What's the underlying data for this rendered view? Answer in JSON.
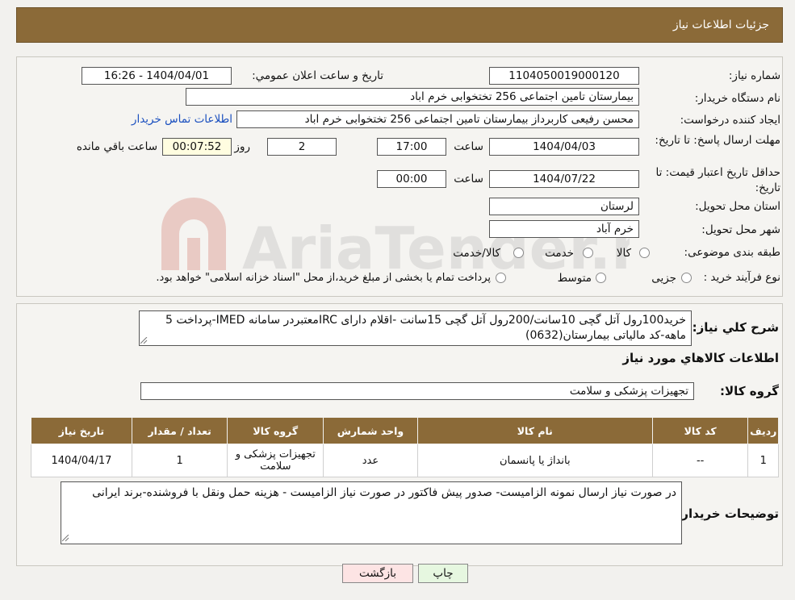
{
  "header": {
    "title": "جزئیات اطلاعات نیاز"
  },
  "form": {
    "need_number_label": "شماره نیاز:",
    "need_number": "1104050019000120",
    "announce_label": "تاریخ و ساعت اعلان عمومي:",
    "announce_value": "1404/04/01 - 16:26",
    "buyer_org_label": "نام دستگاه خریدار:",
    "buyer_org": "بیمارستان تامین اجتماعی  256 تختخوابی خرم اباد",
    "creator_label": "ایجاد کننده درخواست:",
    "creator": "محسن رفیعی کاربرداز بیمارستان تامین اجتماعی  256 تختخوابی خرم اباد",
    "contact_link": "اطلاعات تماس خریدار",
    "deadline_label": "مهلت ارسال پاسخ: تا تاریخ:",
    "deadline_date": "1404/04/03",
    "time_label": "ساعت",
    "deadline_time": "17:00",
    "days_value": "2",
    "days_label": "روز و",
    "remaining_time": "00:07:52",
    "remaining_label": "ساعت باقي مانده",
    "validity_label": "حداقل تاریخ اعتبار قیمت: تا تاریخ:",
    "validity_date": "1404/07/22",
    "validity_time": "00:00",
    "province_label": "استان محل تحویل:",
    "province": "لرستان",
    "city_label": "شهر محل تحویل:",
    "city": "خرم آباد",
    "category_label": "طبقه بندی موضوعی:",
    "category_options": [
      "کالا",
      "خدمت",
      "کالا/خدمت"
    ],
    "process_label": "نوع فرآیند خرید :",
    "process_options": [
      "جزیی",
      "متوسط"
    ],
    "process_note": "پرداخت تمام یا بخشی از مبلغ خرید،از محل \"اسناد خزانه اسلامی\" خواهد بود."
  },
  "description": {
    "label": "شرح کلي نیاز:",
    "text": "خرید100رول آتل گچی 10سانت/200رول آتل گچی 15سانت -اقلام دارای IRCمعتبردر سامانه IMED-پرداخت 5 ماهه-کد مالیاتی بیمارستان(0632)"
  },
  "goods": {
    "section_title": "اطلاعات کالاهاي مورد نیاز",
    "group_label": "گروه کالا:",
    "group_value": "تجهیزات پزشکی و سلامت"
  },
  "table": {
    "headers": [
      "ردیف",
      "کد کالا",
      "نام کالا",
      "واحد شمارش",
      "گروه کالا",
      "تعداد / مقدار",
      "تاریخ نیاز"
    ],
    "rows": [
      [
        "1",
        "--",
        "بانداژ یا پانسمان",
        "عدد",
        "تجهیزات پزشکی و سلامت",
        "1",
        "1404/04/17"
      ]
    ]
  },
  "buyer_notes": {
    "label": "توضیحات خریدار:",
    "text": "در صورت نیاز ارسال نمونه الزامیست- صدور پیش فاکتور در صورت نیاز الزامیست - هزینه حمل ونقل با فروشنده-برند ایرانی"
  },
  "buttons": {
    "print": "چاپ",
    "back": "بازگشت"
  },
  "watermark": {
    "text": "AriaTender.neT"
  }
}
